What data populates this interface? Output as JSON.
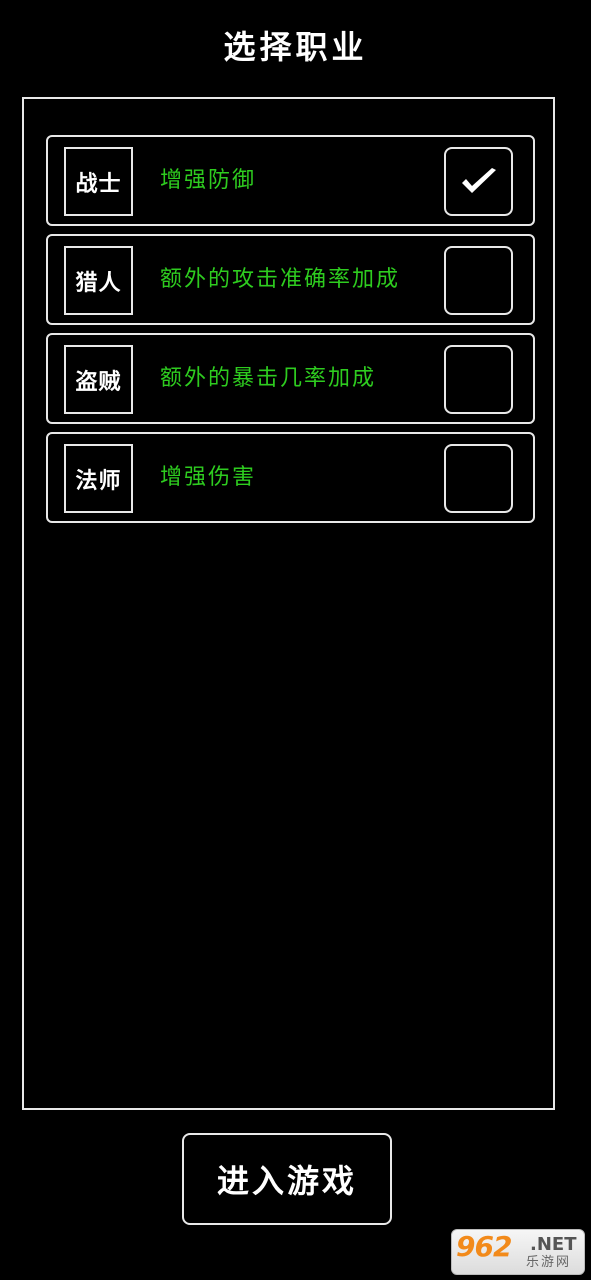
{
  "title": "选择职业",
  "classes": [
    {
      "name": "战士",
      "description": "增强防御",
      "selected": true
    },
    {
      "name": "猎人",
      "description": "额外的攻击准确率加成",
      "selected": false
    },
    {
      "name": "盗贼",
      "description": "额外的暴击几率加成",
      "selected": false
    },
    {
      "name": "法师",
      "description": "增强伤害",
      "selected": false
    }
  ],
  "enter_button": "进入游戏",
  "watermark": {
    "main": "962",
    "net": ".NET",
    "sub": "乐游网"
  },
  "colors": {
    "background": "#000000",
    "border": "#e8e8e8",
    "description": "#2ecc1f",
    "text": "#ffffff"
  },
  "icons": {
    "selected": "checkmark-icon"
  }
}
